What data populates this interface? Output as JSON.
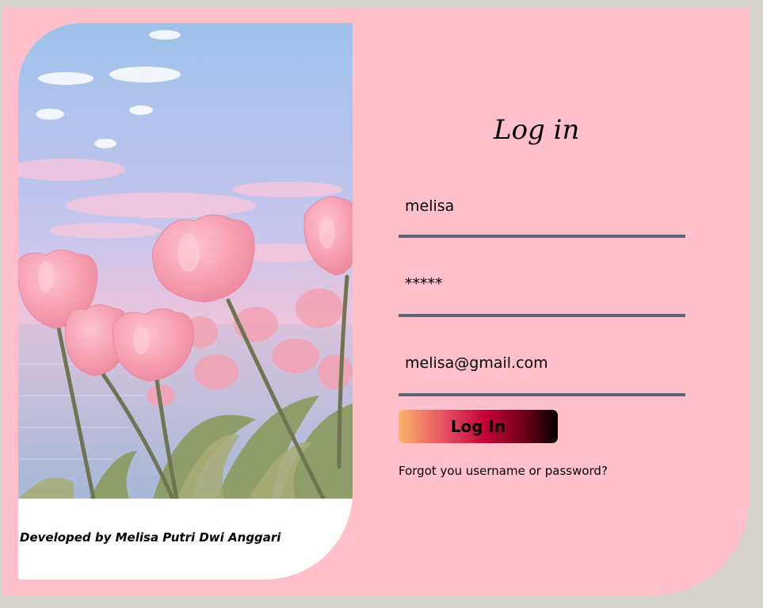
{
  "login": {
    "title": "Log in",
    "username_value": "melisa",
    "password_value": "*****",
    "email_value": "melisa@gmail.com",
    "button_label": "Log In",
    "forgot_link": "Forgot you username or password?"
  },
  "footer": {
    "credit": "Developed by Melisa Putri Dwi Anggari"
  },
  "colors": {
    "card_background": "#ffc0cb",
    "page_background": "#d6d3cc",
    "input_underline": "#5d6470",
    "button_gradient": [
      "#fbb36a",
      "#c40036",
      "#000000"
    ]
  }
}
